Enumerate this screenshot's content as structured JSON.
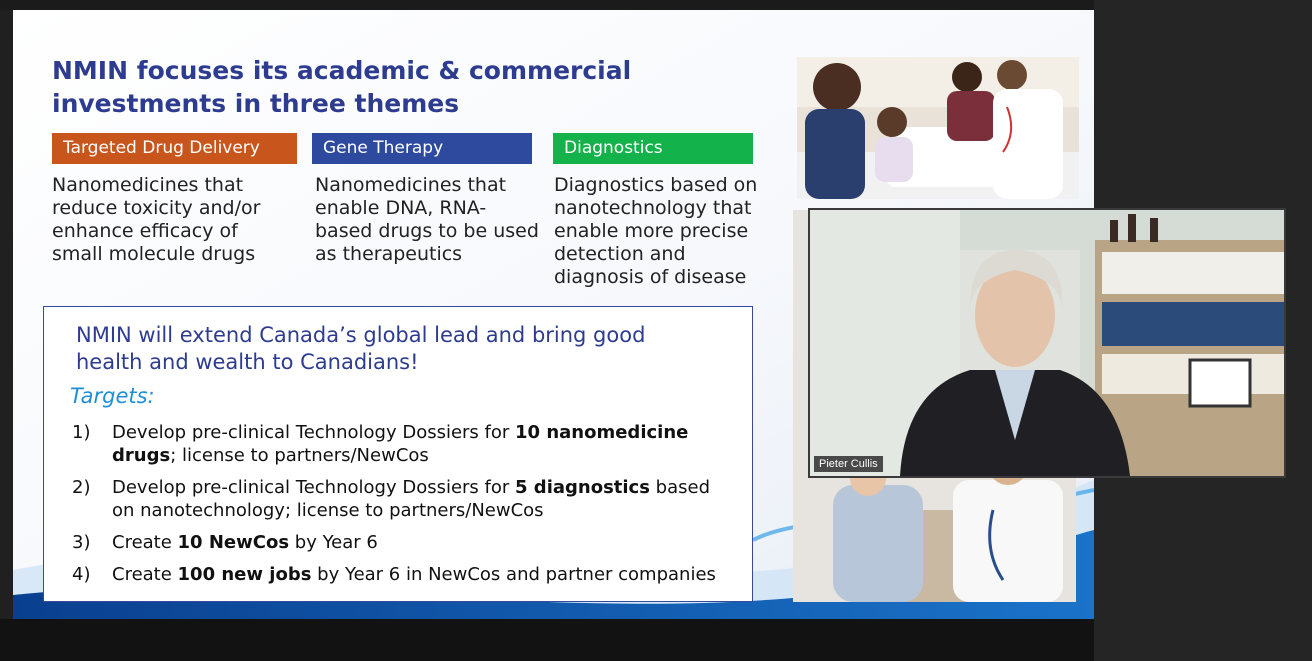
{
  "slide": {
    "title_lines": [
      "NMIN focuses its academic & commercial",
      "investments in three themes"
    ],
    "themes": [
      {
        "label": "Targeted Drug Delivery",
        "color": "#c8561c",
        "description_lines": [
          "Nanomedicines that",
          "reduce toxicity and/or",
          "enhance efficacy of",
          "small molecule drugs"
        ]
      },
      {
        "label": "Gene Therapy",
        "color": "#2e4a9e",
        "description_lines": [
          "Nanomedicines that",
          "enable DNA, RNA-",
          "based drugs to be used",
          "as therapeutics"
        ]
      },
      {
        "label": "Diagnostics",
        "color": "#13b24a",
        "description_lines": [
          "Diagnostics based on",
          "nanotechnology that",
          "enable more precise",
          "detection and",
          "diagnosis of disease"
        ]
      }
    ],
    "targets_box": {
      "headline_lines": [
        "NMIN will extend Canada’s global lead and bring good",
        "health and wealth to Canadians!"
      ],
      "targets_label": "Targets:",
      "items": [
        {
          "num": "1)",
          "l1_pre": "Develop pre-clinical Technology Dossiers for ",
          "l1_bold": "10 nanomedicine",
          "l2_bold": "drugs",
          "l2_post": "; license to partners/NewCos"
        },
        {
          "num": "2)",
          "l1_pre": "Develop pre-clinical Technology Dossiers for ",
          "l1_bold": "5 diagnostics",
          "l1_post": " based",
          "l2_post": "on nanotechnology; license to partners/NewCos"
        },
        {
          "num": "3)",
          "l1_pre": "Create ",
          "l1_bold": "10 NewCos",
          "l1_post": " by Year 6"
        },
        {
          "num": "4)",
          "l1_pre": "Create ",
          "l1_bold": "100 new jobs",
          "l1_post": " by Year 6 in NewCos and partner companies"
        }
      ]
    }
  },
  "video": {
    "participant_name": "Pieter Cullis"
  },
  "colors": {
    "title_blue": "#2d3c8f",
    "targets_label_blue": "#1e8fd6"
  }
}
